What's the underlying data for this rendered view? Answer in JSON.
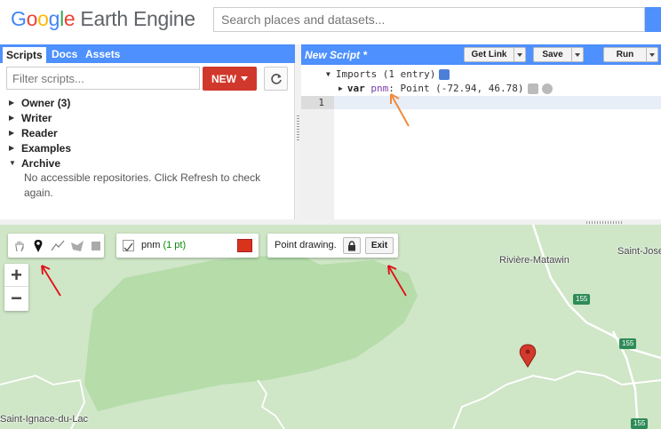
{
  "header": {
    "logo": {
      "g1": "G",
      "g2": "o",
      "g3": "o",
      "g4": "g",
      "g5": "l",
      "g6": "e",
      "rest": "Earth Engine"
    },
    "search_placeholder": "Search places and datasets..."
  },
  "left_panel": {
    "tabs": [
      {
        "label": "Scripts",
        "active": true
      },
      {
        "label": "Docs",
        "active": false
      },
      {
        "label": "Assets",
        "active": false
      }
    ],
    "filter_placeholder": "Filter scripts...",
    "new_button": "NEW",
    "repos": [
      {
        "label": "Owner",
        "count": "(3)",
        "expanded": false
      },
      {
        "label": "Writer",
        "expanded": false
      },
      {
        "label": "Reader",
        "expanded": false
      },
      {
        "label": "Examples",
        "expanded": false
      },
      {
        "label": "Archive",
        "expanded": true
      }
    ],
    "archive_message": "No accessible repositories. Click Refresh to check again."
  },
  "editor": {
    "title": "New Script *",
    "buttons": {
      "get_link": "Get Link",
      "save": "Save",
      "run": "Run"
    },
    "imports_header": "Imports (1 entry)",
    "import_var": {
      "keyword": "var",
      "name": "pnm",
      "rest": ": Point (-72.94, 46.78)"
    },
    "line_number": "1"
  },
  "map": {
    "layer": {
      "name": "pnm",
      "size": "(1 pt)",
      "color": "#d9331c"
    },
    "drawing_label": "Point drawing.",
    "exit_button": "Exit",
    "zoom_in": "+",
    "zoom_out": "−",
    "labels": {
      "riviere": "Rivière-Matawin",
      "saint_jose": "Saint-Jose",
      "saint_ignace": "Saint-Ignace-du-Lac"
    },
    "routes": {
      "r1": "155",
      "r2": "155",
      "r3": "155"
    },
    "colors": {
      "land": "#cfe6c7",
      "park": "#b5dca9",
      "water": "#ffffff",
      "marker": "#d33a2c"
    }
  },
  "icons": [
    "search-icon",
    "refresh-icon",
    "hand-icon",
    "marker-icon",
    "line-icon",
    "polygon-icon",
    "rectangle-icon",
    "lock-icon",
    "map-pin-icon"
  ]
}
